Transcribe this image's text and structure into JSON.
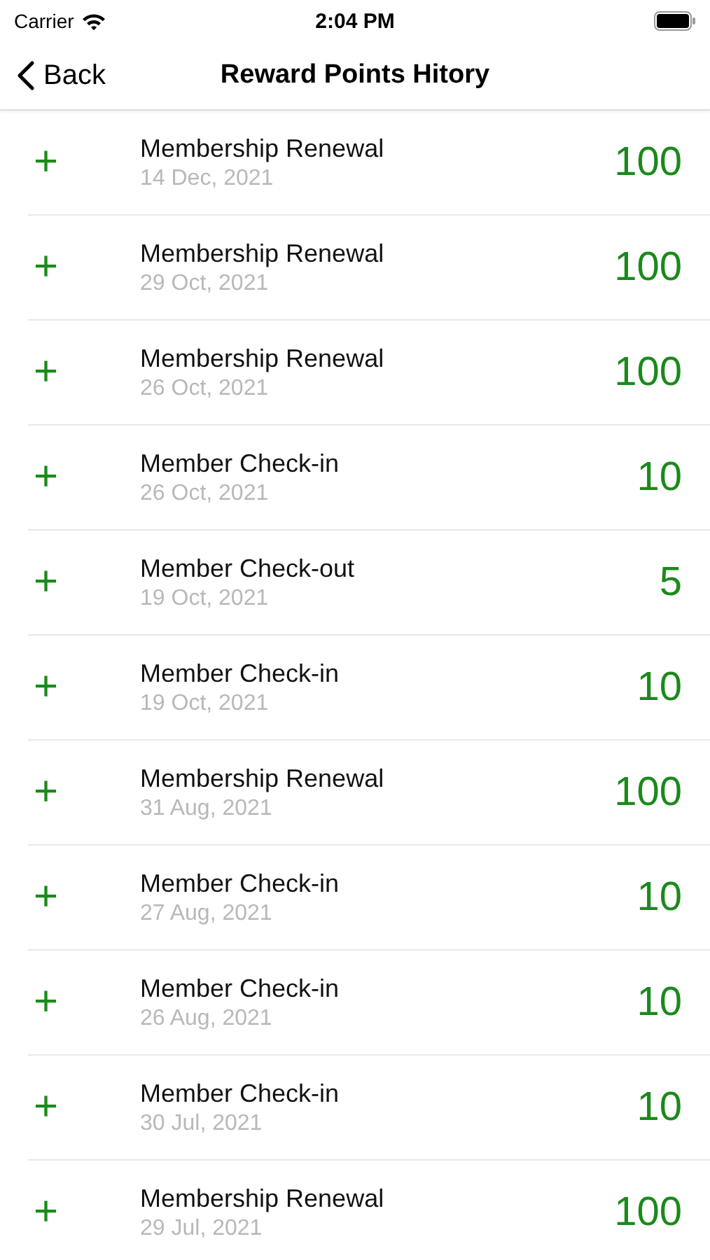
{
  "status_bar": {
    "carrier": "Carrier",
    "time": "2:04 PM"
  },
  "nav": {
    "back": "Back",
    "title": "Reward Points Hitory"
  },
  "entries": [
    {
      "sign": "+",
      "title": "Membership Renewal",
      "date": "14 Dec, 2021",
      "points": "100"
    },
    {
      "sign": "+",
      "title": "Membership Renewal",
      "date": "29 Oct, 2021",
      "points": "100"
    },
    {
      "sign": "+",
      "title": "Membership Renewal",
      "date": "26 Oct, 2021",
      "points": "100"
    },
    {
      "sign": "+",
      "title": "Member Check-in",
      "date": "26 Oct, 2021",
      "points": "10"
    },
    {
      "sign": "+",
      "title": "Member Check-out",
      "date": "19 Oct, 2021",
      "points": "5"
    },
    {
      "sign": "+",
      "title": "Member Check-in",
      "date": "19 Oct, 2021",
      "points": "10"
    },
    {
      "sign": "+",
      "title": "Membership Renewal",
      "date": "31 Aug, 2021",
      "points": "100"
    },
    {
      "sign": "+",
      "title": "Member Check-in",
      "date": "27 Aug, 2021",
      "points": "10"
    },
    {
      "sign": "+",
      "title": "Member Check-in",
      "date": "26 Aug, 2021",
      "points": "10"
    },
    {
      "sign": "+",
      "title": "Member Check-in",
      "date": "30 Jul, 2021",
      "points": "10"
    },
    {
      "sign": "+",
      "title": "Membership Renewal",
      "date": "29 Jul, 2021",
      "points": "100"
    }
  ]
}
